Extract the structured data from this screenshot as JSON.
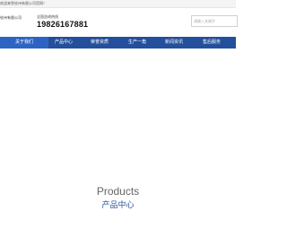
{
  "topbar": {
    "welcome_text": "欢迎来到钦州有限公司官网！"
  },
  "header": {
    "company_name": "钦州有限公司",
    "hotline_label": "全国咨询热线",
    "hotline_number": "19826167881",
    "search_placeholder": "请输入关键字"
  },
  "nav": {
    "items": [
      {
        "label": "关于我们"
      },
      {
        "label": "产品中心"
      },
      {
        "label": "荣誉资质"
      },
      {
        "label": "生产一角"
      },
      {
        "label": "新闻资讯"
      },
      {
        "label": "售后服务"
      }
    ]
  },
  "section": {
    "title_en": "Products",
    "title_cn": "产品中心"
  },
  "colors": {
    "nav_bg": "#244f9c",
    "nav_active": "#2d64c4",
    "title_cn": "#244f9c"
  }
}
